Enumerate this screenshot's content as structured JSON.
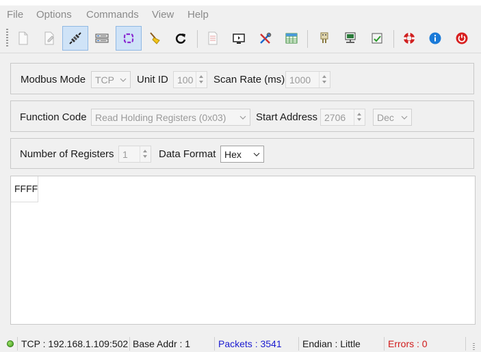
{
  "menu": {
    "file": "File",
    "options": "Options",
    "commands": "Commands",
    "view": "View",
    "help": "Help"
  },
  "toolbar": {
    "buttons": [
      {
        "icon": "open-document-icon",
        "active": false
      },
      {
        "icon": "save-document-icon",
        "active": false
      },
      {
        "icon": "connect-plug-icon",
        "active": true
      },
      {
        "icon": "network-settings-icon",
        "active": false
      },
      {
        "icon": "scan-loop-icon",
        "active": true
      },
      {
        "icon": "clear-broom-icon",
        "active": false
      },
      {
        "icon": "refresh-icon",
        "active": false
      },
      {
        "icon": "log-document-icon",
        "active": false
      },
      {
        "icon": "monitor-display-icon",
        "active": false
      },
      {
        "icon": "tools-icon",
        "active": false
      },
      {
        "icon": "table-grid-icon",
        "active": false
      },
      {
        "icon": "serial-port-icon",
        "active": false
      },
      {
        "icon": "ethernet-icon",
        "active": false
      },
      {
        "icon": "test-check-icon",
        "active": false
      },
      {
        "icon": "help-lifebuoy-icon",
        "active": false
      },
      {
        "icon": "info-icon",
        "active": false
      },
      {
        "icon": "power-icon",
        "active": false
      }
    ]
  },
  "mode_group": {
    "modbus_mode_label": "Modbus Mode",
    "modbus_mode_value": "TCP",
    "unit_id_label": "Unit ID",
    "unit_id_value": "100",
    "scan_rate_label": "Scan Rate (ms)",
    "scan_rate_value": "1000"
  },
  "function_group": {
    "function_code_label": "Function Code",
    "function_code_value": "Read Holding Registers (0x03)",
    "start_address_label": "Start Address",
    "start_address_value": "2706",
    "address_format_value": "Dec"
  },
  "registers_group": {
    "num_registers_label": "Number of Registers",
    "num_registers_value": "1",
    "data_format_label": "Data Format",
    "data_format_value": "Hex"
  },
  "data": {
    "cells": [
      "FFFF"
    ]
  },
  "status": {
    "connection": "TCP : 192.168.1.109:502",
    "base_addr": "Base Addr : 1",
    "packets": "Packets : 3541",
    "endian": "Endian : Little",
    "errors": "Errors : 0"
  },
  "colors": {
    "packets": "#1a1ad0",
    "errors": "#d01a1a",
    "active_button_bg": "#cfe3f7",
    "led": "#3f9a1c"
  }
}
